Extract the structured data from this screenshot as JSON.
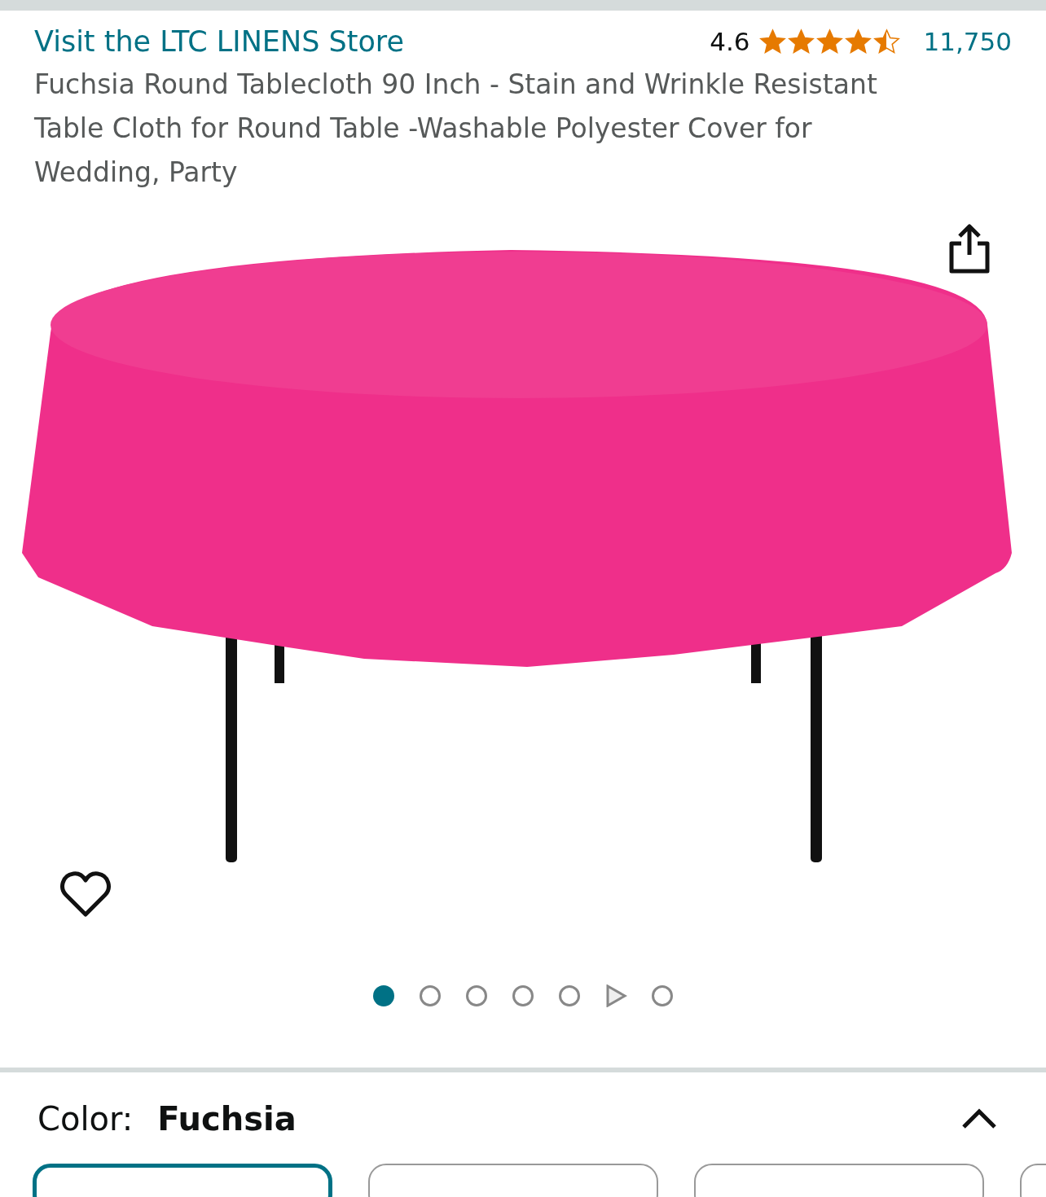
{
  "store_link": "Visit the LTC LINENS Store",
  "rating": {
    "value": "4.6",
    "stars": 4.5,
    "count": "11,750"
  },
  "title": "Fuchsia Round Tablecloth 90 Inch - Stain and Wrinkle Resistant Table Cloth for Round Table -Washable Polyester Cover for Wedding, Party",
  "carousel": [
    {
      "kind": "image",
      "selected": true
    },
    {
      "kind": "image",
      "selected": false
    },
    {
      "kind": "image",
      "selected": false
    },
    {
      "kind": "image",
      "selected": false
    },
    {
      "kind": "image",
      "selected": false
    },
    {
      "kind": "video",
      "selected": false
    },
    {
      "kind": "image",
      "selected": false
    }
  ],
  "color_selector": {
    "label": "Color:",
    "value": "Fuchsia",
    "expanded": true
  },
  "swatches": [
    {
      "selected": true
    },
    {
      "selected": false
    },
    {
      "selected": false
    },
    {
      "selected": false
    }
  ]
}
